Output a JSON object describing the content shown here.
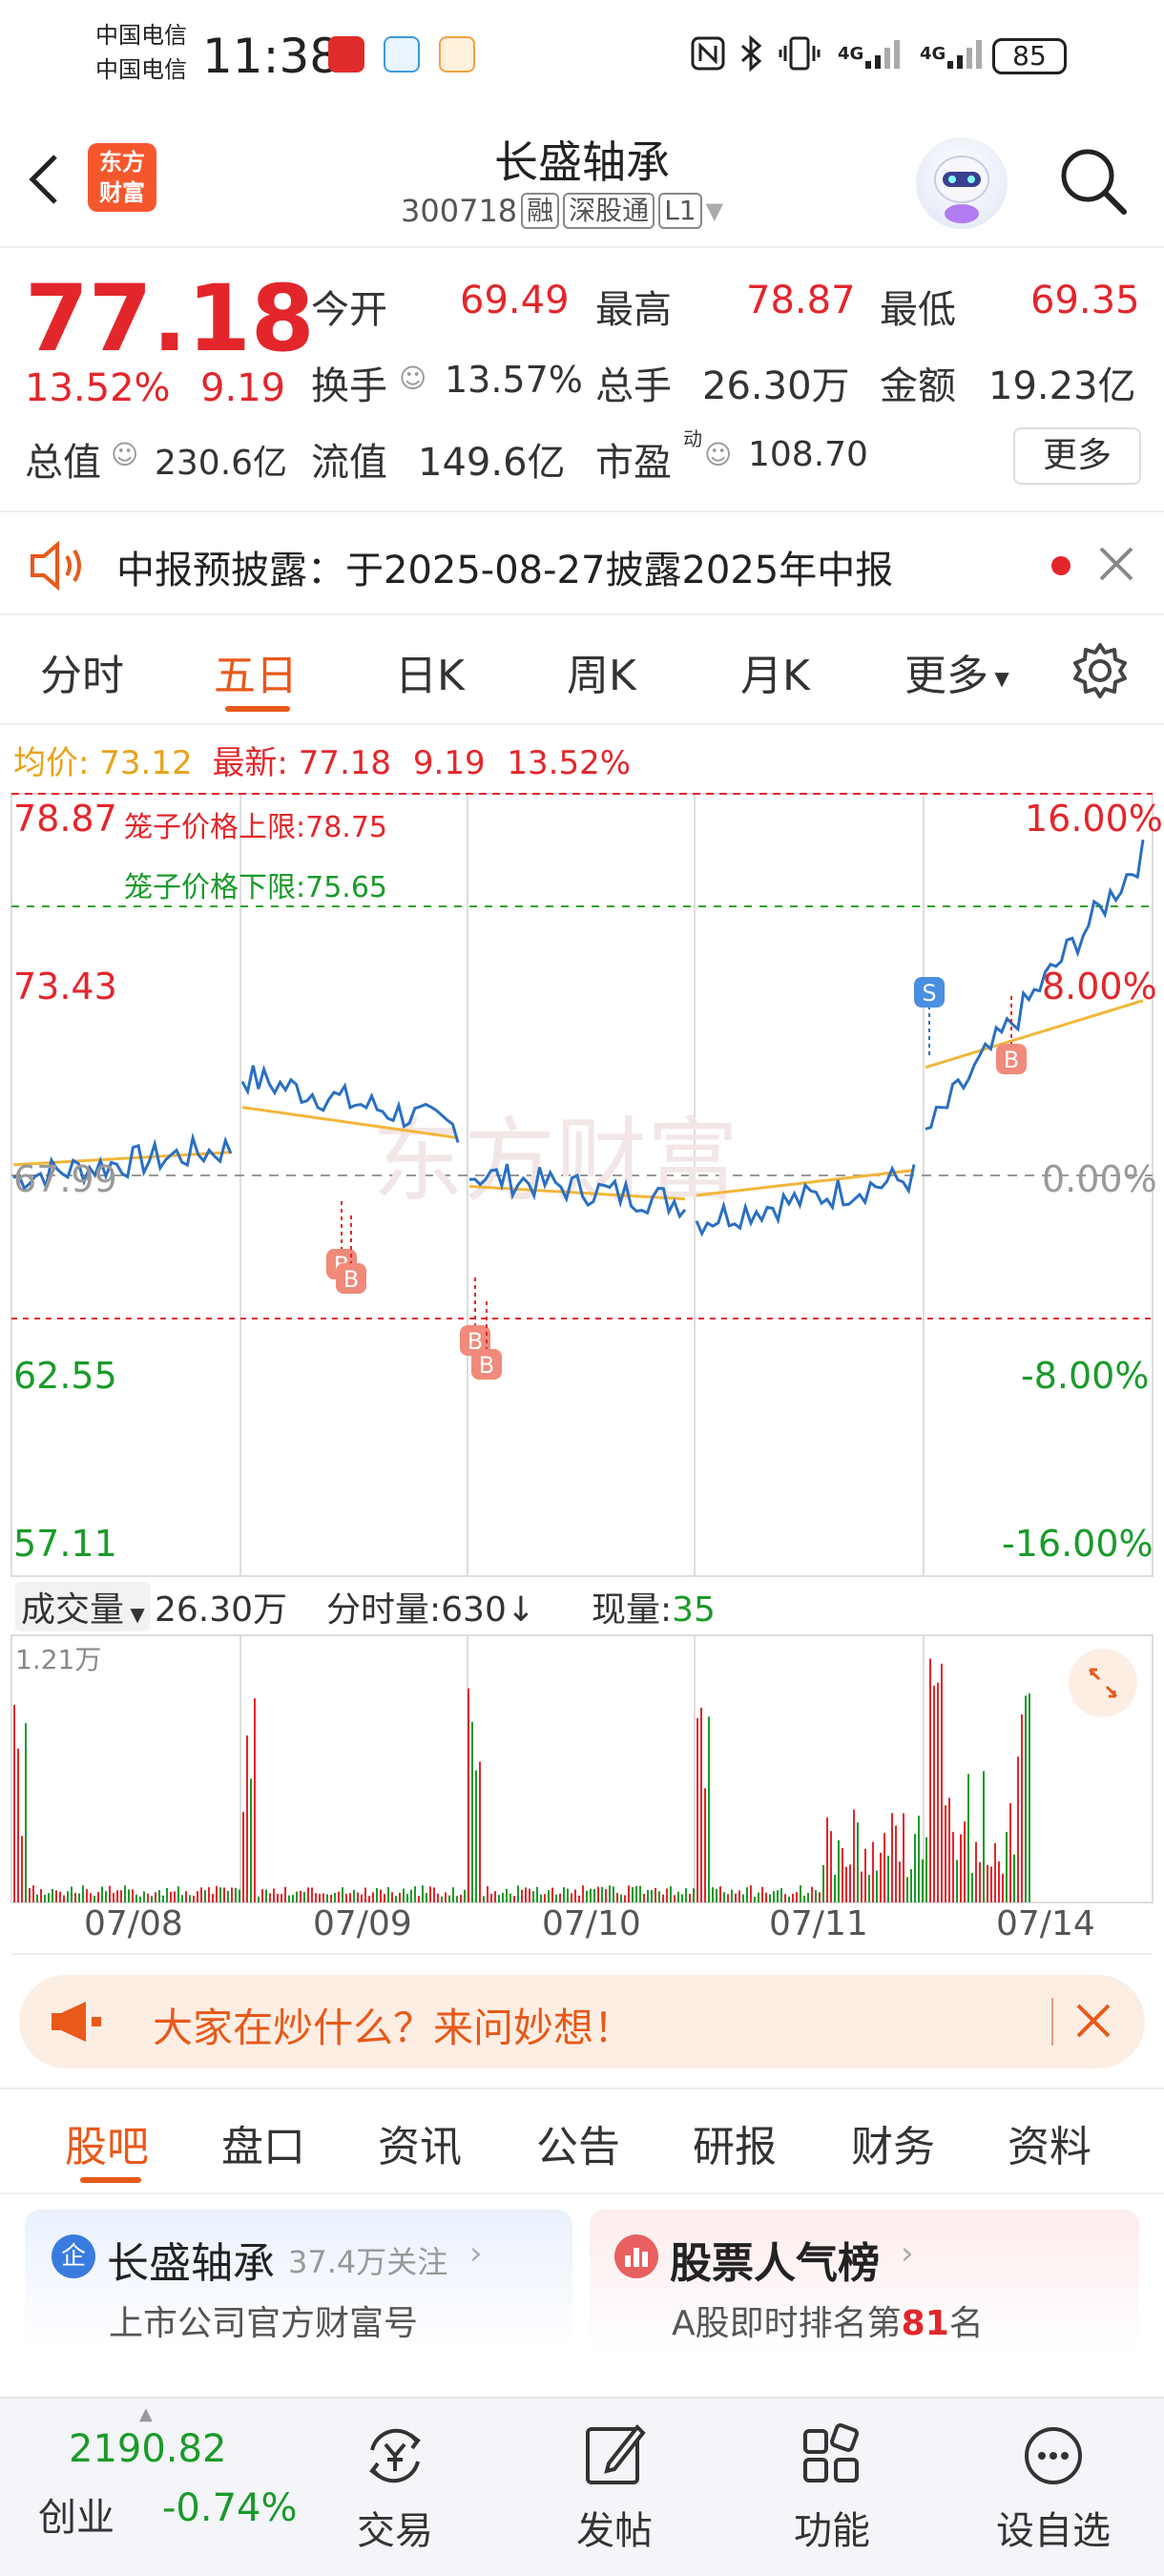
{
  "status_bar": {
    "carrier_1": "中国电信",
    "carrier_2": "中国电信",
    "time": "11:38",
    "network_1": "4G",
    "network_2": "4G",
    "battery": "85"
  },
  "header": {
    "logo_text_1": "东方",
    "logo_text_2": "财富",
    "title": "长盛轴承",
    "code": "300718",
    "tag_rong": "融",
    "tag_connect": "深股通",
    "tag_level": "L1"
  },
  "quote": {
    "price": "77.18",
    "change_pct": "13.52%",
    "change": "9.19",
    "open_label": "今开",
    "open": "69.49",
    "high_label": "最高",
    "high": "78.87",
    "low_label": "最低",
    "low": "69.35",
    "turnover_label": "换手",
    "turnover": "13.57%",
    "volume_label": "总手",
    "volume": "26.30万",
    "amount_label": "金额",
    "amount": "19.23亿",
    "mktcap_label": "总值",
    "mktcap": "230.6亿",
    "float_label": "流值",
    "float": "149.6亿",
    "pe_label": "市盈",
    "pe_sup": "动",
    "pe": "108.70",
    "more_label": "更多"
  },
  "notice": {
    "text": "中报预披露：于2025-08-27披露2025年中报"
  },
  "chart_tabs": [
    "分时",
    "五日",
    "日K",
    "周K",
    "月K",
    "更多"
  ],
  "chart_tab_active": "五日",
  "info_row": {
    "avg_label": "均价:",
    "avg": "73.12",
    "latest_label": "最新:",
    "latest": "77.18",
    "chg": "9.19",
    "chg_pct": "13.52%"
  },
  "chart_labels": {
    "cage_upper_label": "笼子价格上限:",
    "cage_upper": "78.75",
    "cage_lower_label": "笼子价格下限:",
    "cage_lower": "75.65",
    "left_axis": [
      "78.87",
      "73.43",
      "67.99",
      "62.55",
      "57.11"
    ],
    "right_axis": [
      "16.00%",
      "8.00%",
      "0.00%",
      "-8.00%",
      "-16.00%"
    ],
    "dates": [
      "07/08",
      "07/09",
      "07/10",
      "07/11",
      "07/14"
    ],
    "vol_max": "1.21万",
    "watermark": "东方财富"
  },
  "volume_header": {
    "label": "成交量",
    "total": "26.30万",
    "tick_label": "分时量:630",
    "current_label": "现量:",
    "current": "35"
  },
  "chart_data": {
    "type": "line",
    "x": [
      "07/08",
      "07/09",
      "07/10",
      "07/11",
      "07/14"
    ],
    "ylim": [
      57.11,
      78.87
    ],
    "reference_price": 67.99,
    "series": [
      {
        "name": "最新",
        "close_by_day": [
          69.0,
          69.6,
          67.5,
          68.2,
          77.18
        ]
      },
      {
        "name": "均价",
        "close_by_day": [
          68.9,
          69.3,
          67.6,
          68.4,
          73.12
        ]
      }
    ],
    "cage_upper": 78.75,
    "cage_lower": 75.65,
    "markers": [
      {
        "day": "07/09",
        "type": "B"
      },
      {
        "day": "07/09",
        "type": "B"
      },
      {
        "day": "07/10",
        "type": "B"
      },
      {
        "day": "07/10",
        "type": "B"
      },
      {
        "day": "07/14",
        "type": "S"
      },
      {
        "day": "07/14",
        "type": "B"
      }
    ]
  },
  "banner": {
    "text": "大家在炒什么？来问妙想！"
  },
  "bottom_tabs": [
    "股吧",
    "盘口",
    "资讯",
    "公告",
    "研报",
    "财务",
    "资料"
  ],
  "bottom_tab_active": "股吧",
  "cards": {
    "left_title": "长盛轴承",
    "left_followers": "37.4万关注",
    "left_sub": "上市公司官方财富号",
    "right_title": "股票人气榜",
    "right_sub_prefix": "A股即时排名第",
    "right_rank": "81",
    "right_sub_suffix": "名"
  },
  "bottom_nav": {
    "index_value": "2190.82",
    "index_name": "创业",
    "index_change": "-0.74%",
    "items": [
      "交易",
      "发帖",
      "功能",
      "设自选"
    ]
  },
  "colors": {
    "up": "#e3262b",
    "down": "#1a9a2a",
    "accent": "#e8591a",
    "price_line": "#2a6fc2",
    "avg_line": "#f2b63a"
  }
}
